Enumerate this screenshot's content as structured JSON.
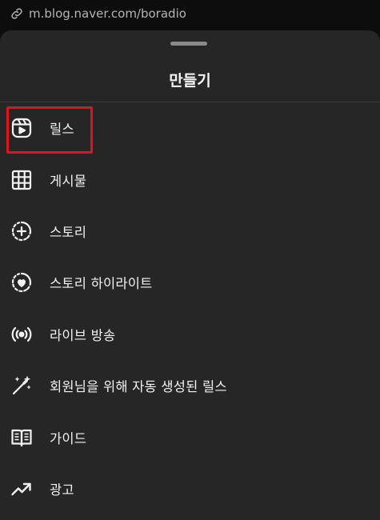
{
  "url_bar": {
    "url": "m.blog.naver.com/boradio"
  },
  "sheet": {
    "title": "만들기"
  },
  "menu": {
    "items": [
      {
        "label": "릴스",
        "icon": "reels-icon"
      },
      {
        "label": "게시물",
        "icon": "grid-icon"
      },
      {
        "label": "스토리",
        "icon": "story-add-icon"
      },
      {
        "label": "스토리 하이라이트",
        "icon": "highlight-heart-icon"
      },
      {
        "label": "라이브 방송",
        "icon": "live-broadcast-icon"
      },
      {
        "label": "회원님을 위해 자동 생성된 릴스",
        "icon": "magic-wand-icon"
      },
      {
        "label": "가이드",
        "icon": "guide-book-icon"
      },
      {
        "label": "광고",
        "icon": "trending-up-icon"
      }
    ]
  },
  "colors": {
    "sheet_background": "#262626",
    "highlight_border": "#e0141e",
    "text": "#f2f2f2"
  }
}
